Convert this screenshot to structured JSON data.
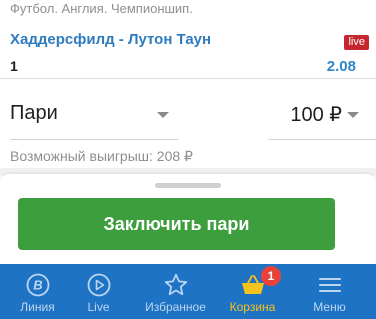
{
  "event": {
    "league": "Футбол. Англия. Чемпионшип.",
    "title": "Хаддерсфилд - Лутон Таун",
    "live_badge": "live",
    "outcome": "1",
    "odds": "2.08"
  },
  "bet_form": {
    "bet_type": "Пари",
    "amount": "100 ₽",
    "possible_win": "Возможный выигрыш: 208 ₽",
    "submit_label": "Заключить пари"
  },
  "tabbar": {
    "items": [
      {
        "label": "Линия",
        "icon": "line-b-icon"
      },
      {
        "label": "Live",
        "icon": "play-icon"
      },
      {
        "label": "Избранное",
        "icon": "star-icon"
      },
      {
        "label": "Корзина",
        "icon": "basket-icon",
        "active": true
      },
      {
        "label": "Меню",
        "icon": "menu-icon"
      }
    ],
    "cart_count": "1"
  },
  "colors": {
    "accent_blue": "#1e73c4",
    "title_blue": "#2e7bbd",
    "odds_blue": "#2e87c8",
    "button_green": "#3d9e3d",
    "live_red": "#c6262e",
    "active_tab": "#f7c21b",
    "badge_red": "#e8423a"
  }
}
